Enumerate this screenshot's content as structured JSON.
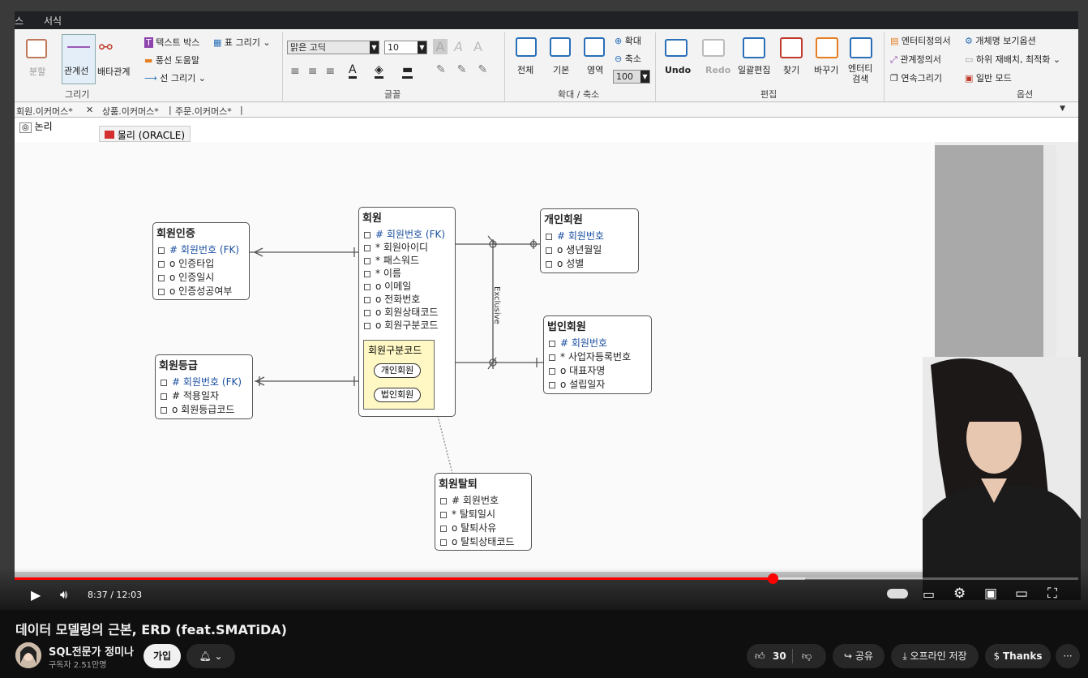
{
  "app": {
    "menu": [
      "스",
      "서식"
    ],
    "ribbon": {
      "draw_group": {
        "split": "분할",
        "relation_line": "관계선",
        "exclusive_relation": "배타관계",
        "text_box": "텍스트 박스",
        "table_draw": "표 그리기",
        "balloon_help": "풍선 도움말",
        "line_draw": "선 그리기",
        "label": "그리기"
      },
      "font_group": {
        "font_name": "맑은 고딕",
        "font_size": "10",
        "label": "글꼴"
      },
      "zoom_group": {
        "all": "전체",
        "basic": "기본",
        "area": "영역",
        "zoom_in": "확대",
        "zoom_out": "축소",
        "zoom_value": "100",
        "label": "확대 / 축소"
      },
      "edit_group": {
        "undo": "Undo",
        "redo": "Redo",
        "bulk_edit": "일괄편집",
        "find": "찾기",
        "replace": "바꾸기",
        "entity_search_1": "엔터티",
        "entity_search_2": "검색",
        "label": "편집"
      },
      "options_group": {
        "entity_def": "엔터티정의서",
        "relation_def": "관계정의서",
        "continuous_draw": "연속그리기",
        "object_name_opt": "개체명 보기옵션",
        "sub_relayout": "하위 재배치, 최적화",
        "normal_mode": "일반 모드",
        "label": "옵션"
      }
    },
    "doc_tabs": [
      "회원.이커머스*",
      "상품.이커머스*",
      "주문.이커머스*"
    ],
    "sub_tabs": {
      "logical": "논리",
      "physical": "물리 (ORACLE)"
    },
    "erd": {
      "entities": [
        {
          "id": "auth",
          "name": "회원인증",
          "rows": [
            {
              "mark": "#",
              "text": "회원번호",
              "fk": "(FK)",
              "key": true
            },
            {
              "mark": "o",
              "text": "인증타입"
            },
            {
              "mark": "o",
              "text": "인증일시"
            },
            {
              "mark": "o",
              "text": "인증성공여부"
            }
          ]
        },
        {
          "id": "grade",
          "name": "회원등급",
          "rows": [
            {
              "mark": "#",
              "text": "회원번호",
              "fk": "(FK)",
              "key": true
            },
            {
              "mark": "#",
              "text": "적용일자"
            },
            {
              "mark": "o",
              "text": "회원등급코드"
            }
          ]
        },
        {
          "id": "member",
          "name": "회원",
          "rows": [
            {
              "mark": "#",
              "text": "회원번호",
              "fk": "(FK)",
              "key": true
            },
            {
              "mark": "*",
              "text": "회원아이디"
            },
            {
              "mark": "*",
              "text": "패스워드"
            },
            {
              "mark": "*",
              "text": "이름"
            },
            {
              "mark": "o",
              "text": "이메일"
            },
            {
              "mark": "o",
              "text": "전화번호"
            },
            {
              "mark": "o",
              "text": "회원상태코드"
            },
            {
              "mark": "o",
              "text": "회원구분코드"
            }
          ]
        },
        {
          "id": "personal",
          "name": "개인회원",
          "rows": [
            {
              "mark": "#",
              "text": "회원번호",
              "key": true
            },
            {
              "mark": "o",
              "text": "생년월일"
            },
            {
              "mark": "o",
              "text": "성별"
            }
          ]
        },
        {
          "id": "corp",
          "name": "법인회원",
          "rows": [
            {
              "mark": "#",
              "text": "회원번호",
              "key": true
            },
            {
              "mark": "*",
              "text": "사업자등록번호"
            },
            {
              "mark": "o",
              "text": "대표자명"
            },
            {
              "mark": "o",
              "text": "설립일자"
            }
          ]
        },
        {
          "id": "withdraw",
          "name": "회원탈퇴",
          "rows": [
            {
              "mark": "#",
              "text": "회원번호"
            },
            {
              "mark": "*",
              "text": "탈퇴일시"
            },
            {
              "mark": "o",
              "text": "탈퇴사유"
            },
            {
              "mark": "o",
              "text": "탈퇴상태코드"
            }
          ]
        }
      ],
      "subtype": {
        "title": "회원구분코드",
        "types": [
          "개인회원",
          "법인회원"
        ]
      },
      "exclusive_label": "Exclusive"
    }
  },
  "player": {
    "time": "8:37 / 12:03",
    "progress_fraction": 0.7127,
    "buffered_fraction": 0.743
  },
  "video": {
    "title": "데이터 모델링의 근본, ERD (feat.SMATiDA)",
    "channel": "SQL전문가 정미나",
    "subscribers": "구독자 2.51만명",
    "join": "가입",
    "likes": "30",
    "share": "공유",
    "offline": "오프라인 저장",
    "thanks": "Thanks",
    "more": "···"
  },
  "colors": {
    "progress": "#ff0000",
    "key_text": "#1a4fa0",
    "subtype_bg": "#fff8c4",
    "page_bg": "#0f0f0f"
  }
}
